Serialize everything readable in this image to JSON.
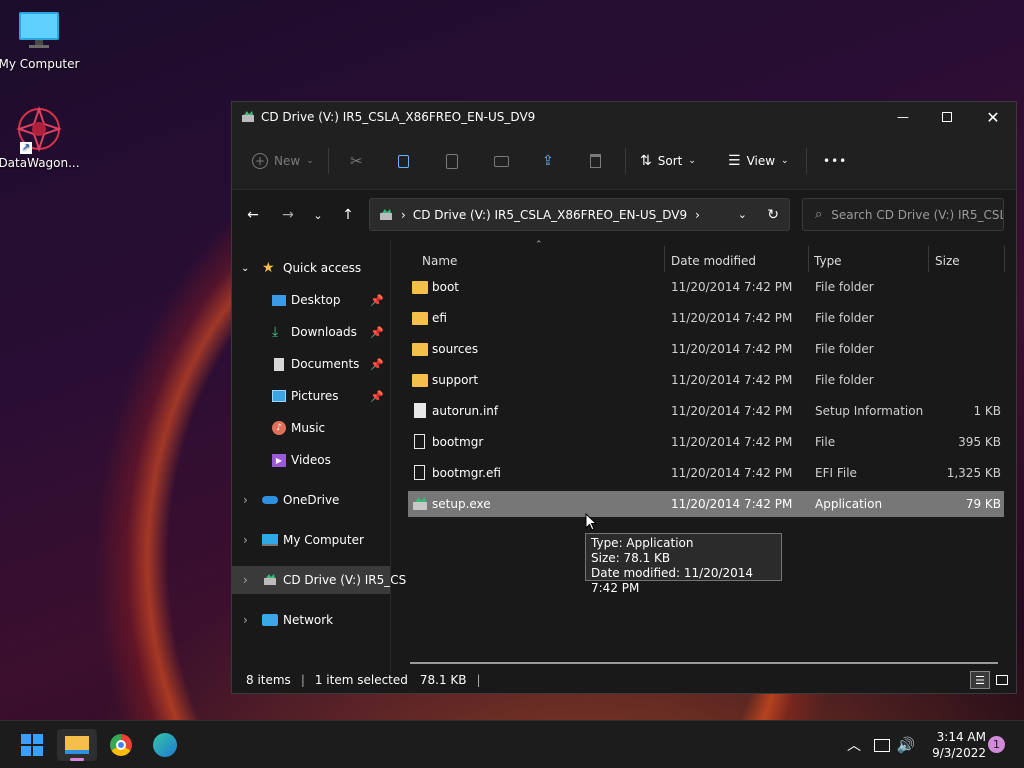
{
  "desktop": {
    "icons": [
      {
        "label": "My Computer",
        "icon": "monitor-icon"
      },
      {
        "label": "DataWagon...",
        "icon": "datawagon-icon"
      }
    ]
  },
  "window": {
    "title": "CD Drive (V:) IR5_CSLA_X86FREO_EN-US_DV9",
    "controls": [
      "minimize",
      "maximize",
      "close"
    ]
  },
  "toolbar": {
    "new_label": "New",
    "sort_label": "Sort",
    "view_label": "View",
    "more_label": "•••"
  },
  "address": {
    "path": "CD Drive (V:) IR5_CSLA_X86FREO_EN-US_DV9",
    "search_placeholder": "Search CD Drive (V:) IR5_CSL..."
  },
  "nav": {
    "quick_access": "Quick access",
    "items": [
      {
        "label": "Desktop",
        "icon": "desktop-icon",
        "pinned": true
      },
      {
        "label": "Downloads",
        "icon": "downloads-icon",
        "pinned": true
      },
      {
        "label": "Documents",
        "icon": "documents-icon",
        "pinned": true
      },
      {
        "label": "Pictures",
        "icon": "pictures-icon",
        "pinned": true
      },
      {
        "label": "Music",
        "icon": "music-icon",
        "pinned": false
      },
      {
        "label": "Videos",
        "icon": "videos-icon",
        "pinned": false
      }
    ],
    "onedrive": "OneDrive",
    "my_computer": "My Computer",
    "cd_drive": "CD Drive (V:) IR5_CS",
    "network": "Network"
  },
  "columns": {
    "name": "Name",
    "date": "Date modified",
    "type": "Type",
    "size": "Size"
  },
  "files": [
    {
      "name": "boot",
      "date": "11/20/2014 7:42 PM",
      "type": "File folder",
      "size": "",
      "icon": "folder-icon"
    },
    {
      "name": "efi",
      "date": "11/20/2014 7:42 PM",
      "type": "File folder",
      "size": "",
      "icon": "folder-icon"
    },
    {
      "name": "sources",
      "date": "11/20/2014 7:42 PM",
      "type": "File folder",
      "size": "",
      "icon": "folder-icon"
    },
    {
      "name": "support",
      "date": "11/20/2014 7:42 PM",
      "type": "File folder",
      "size": "",
      "icon": "folder-icon"
    },
    {
      "name": "autorun.inf",
      "date": "11/20/2014 7:42 PM",
      "type": "Setup Information",
      "size": "1 KB",
      "icon": "setup-info-icon"
    },
    {
      "name": "bootmgr",
      "date": "11/20/2014 7:42 PM",
      "type": "File",
      "size": "395 KB",
      "icon": "file-icon"
    },
    {
      "name": "bootmgr.efi",
      "date": "11/20/2014 7:42 PM",
      "type": "EFI File",
      "size": "1,325 KB",
      "icon": "file-icon"
    },
    {
      "name": "setup.exe",
      "date": "11/20/2014 7:42 PM",
      "type": "Application",
      "size": "79 KB",
      "icon": "setup-exe-icon",
      "selected": true
    }
  ],
  "tooltip": {
    "line1": "Type: Application",
    "line2": "Size: 78.1 KB",
    "line3": "Date modified: 11/20/2014 7:42 PM"
  },
  "status": {
    "items": "8 items",
    "selected": "1 item selected",
    "size": "78.1 KB"
  },
  "taskbar": {
    "time": "3:14 AM",
    "date": "9/3/2022",
    "notification_count": "1"
  },
  "colors": {
    "accent": "#0078d4",
    "folder": "#f5c04a",
    "selection": "#777777"
  }
}
